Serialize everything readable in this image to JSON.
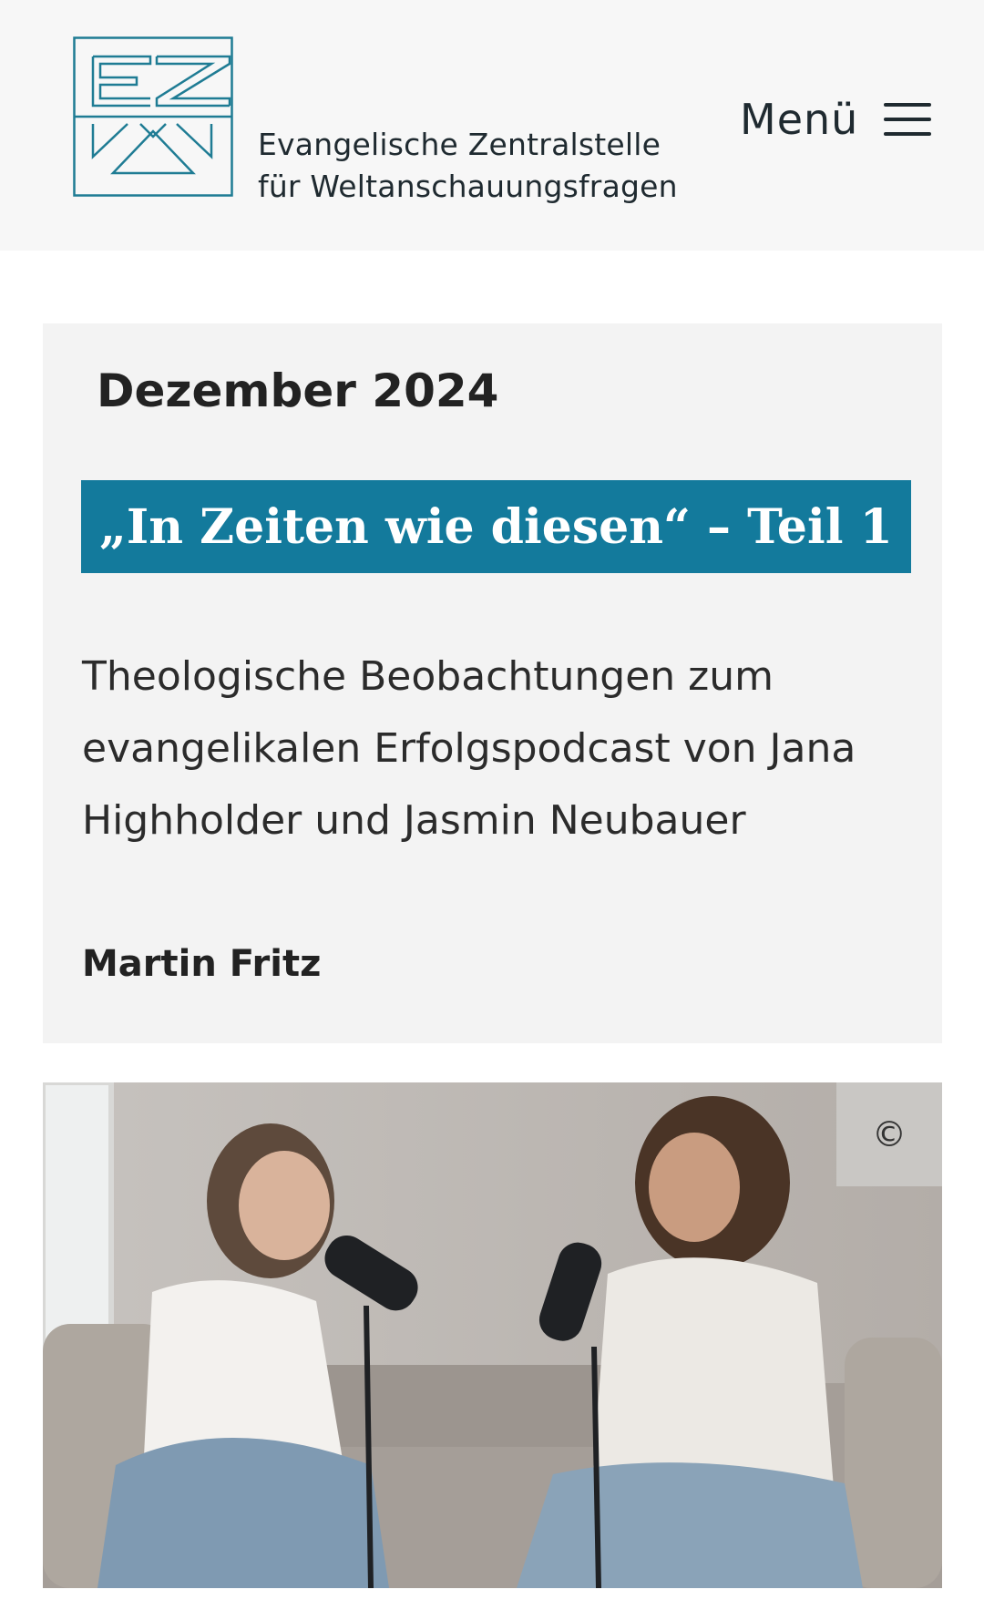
{
  "header": {
    "logo_alt": "EZW",
    "org_line1": "Evangelische Zentralstelle",
    "org_line2": "für Weltanschauungsfragen",
    "menu_label": "Menü",
    "menu_icon": "hamburger-icon"
  },
  "article": {
    "date": "Dezember 2024",
    "title": "„In Zeiten wie diesen“ – Teil 1",
    "subtitle": "Theologische Beobachtungen zum evangelikalen Erfolgspodcast von Jana Highholder und Jasmin Neubauer",
    "author": "Martin Fritz"
  },
  "image": {
    "copyright_symbol": "©"
  },
  "colors": {
    "accent": "#137a9c",
    "logo": "#1f7c94",
    "header_bg": "#f7f7f7",
    "card_bg": "#f3f3f3"
  }
}
